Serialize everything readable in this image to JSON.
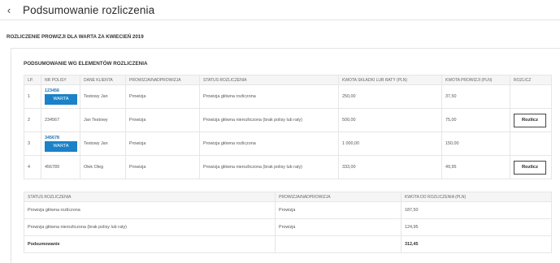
{
  "header": {
    "back_glyph": "‹",
    "title": "Podsumowanie rozliczenia"
  },
  "subheading": "ROZLICZENIE PROWIZJI DLA WARTA ZA KWIECIEŃ 2019",
  "card": {
    "title": "PODSUMOWANIE WG ELEMENTÓW ROZLICZENIA"
  },
  "main_table": {
    "headers": [
      "LP.",
      "NR POLISY",
      "DANE KLIENTA",
      "PROWIZJA/NADPROWIZJA",
      "STATUS ROZLICZENIA",
      "KWOTA SKŁADKI LUB RATY (PLN)",
      "KWOTA PROWIZJI (PLN)",
      "ROZLICZ"
    ],
    "rows": [
      {
        "lp": "1",
        "policy": "123456",
        "warta": "WARTA",
        "client": "Testowy Jan",
        "type": "Prowizja",
        "status": "Prowizja główna rozliczona",
        "premium": "250,00",
        "commission": "37,50",
        "settle": ""
      },
      {
        "lp": "2",
        "policy": "234567",
        "warta": "",
        "client": "Jan Testowy",
        "type": "Prowizja",
        "status": "Prowizja główna nierozliczona (brak polisy lub raty)",
        "premium": "500,00",
        "commission": "75,00",
        "settle": "Rozlicz"
      },
      {
        "lp": "3",
        "policy": "345678",
        "warta": "WARTA",
        "client": "Testowy Jan",
        "type": "Prowizja",
        "status": "Prowizja główna rozliczona",
        "premium": "1 000,00",
        "commission": "150,00",
        "settle": ""
      },
      {
        "lp": "4",
        "policy": "456789",
        "warta": "",
        "client": "Olek Oleg",
        "type": "Prowizja",
        "status": "Prowizja główna nierozliczona (brak polisy lub raty)",
        "premium": "333,00",
        "commission": "49,95",
        "settle": "Rozlicz"
      }
    ]
  },
  "summary_table": {
    "headers": [
      "STATUS ROZLICZENIA",
      "PROWIZJA/NADPROWIZJA",
      "KWOTA DO ROZLICZENIA (PLN)"
    ],
    "rows": [
      {
        "status": "Prowizja główna rozliczona",
        "type": "Prowizja",
        "amount": "187,50"
      },
      {
        "status": "Prowizja główna nierozliczona (brak polisy lub raty)",
        "type": "Prowizja",
        "amount": "124,95"
      }
    ],
    "total": {
      "label": "Podsumowanie",
      "type": "",
      "amount": "312,45"
    }
  }
}
